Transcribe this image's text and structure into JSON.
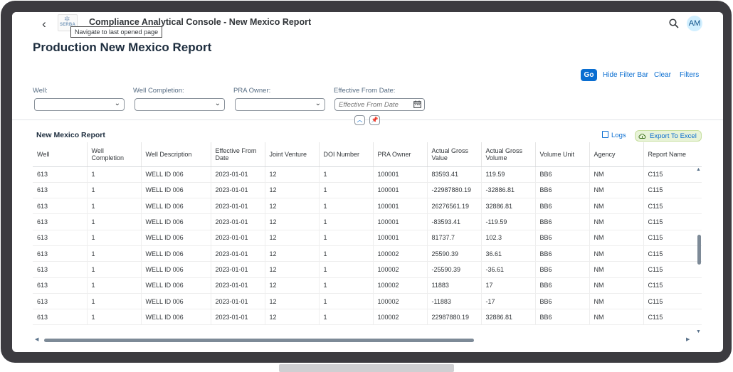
{
  "app": {
    "title": "Compliance Analytical Console - New Mexico Report",
    "logo_text": "SERBA",
    "tooltip": "Navigate to last opened page",
    "avatar_initials": "AM"
  },
  "page": {
    "title": "Production New Mexico Report"
  },
  "filterbar": {
    "go_label": "Go",
    "hide_label": "Hide Filter Bar",
    "clear_label": "Clear",
    "filters_label": "Filters",
    "well_label": "Well:",
    "well_completion_label": "Well Completion:",
    "pra_owner_label": "PRA Owner:",
    "eff_date_label": "Effective From Date:",
    "eff_date_placeholder": "Effective From Date"
  },
  "table": {
    "title": "New Mexico Report",
    "logs_label": "Logs",
    "export_label": "Export To Excel",
    "columns": [
      "Well",
      "Well Completion",
      "Well Description",
      "Effective From Date",
      "Joint Venture",
      "DOI Number",
      "PRA Owner",
      "Actual Gross Value",
      "Actual Gross Volume",
      "Volume Unit",
      "Agency",
      "Report Name"
    ],
    "rows": [
      [
        "613",
        "1",
        "WELL ID 006",
        "2023-01-01",
        "12",
        "1",
        "100001",
        "83593.41",
        "119.59",
        "BB6",
        "NM",
        "C115"
      ],
      [
        "613",
        "1",
        "WELL ID 006",
        "2023-01-01",
        "12",
        "1",
        "100001",
        "-22987880.19",
        "-32886.81",
        "BB6",
        "NM",
        "C115"
      ],
      [
        "613",
        "1",
        "WELL ID 006",
        "2023-01-01",
        "12",
        "1",
        "100001",
        "26276561.19",
        "32886.81",
        "BB6",
        "NM",
        "C115"
      ],
      [
        "613",
        "1",
        "WELL ID 006",
        "2023-01-01",
        "12",
        "1",
        "100001",
        "-83593.41",
        "-119.59",
        "BB6",
        "NM",
        "C115"
      ],
      [
        "613",
        "1",
        "WELL ID 006",
        "2023-01-01",
        "12",
        "1",
        "100001",
        "81737.7",
        "102.3",
        "BB6",
        "NM",
        "C115"
      ],
      [
        "613",
        "1",
        "WELL ID 006",
        "2023-01-01",
        "12",
        "1",
        "100002",
        "25590.39",
        "36.61",
        "BB6",
        "NM",
        "C115"
      ],
      [
        "613",
        "1",
        "WELL ID 006",
        "2023-01-01",
        "12",
        "1",
        "100002",
        "-25590.39",
        "-36.61",
        "BB6",
        "NM",
        "C115"
      ],
      [
        "613",
        "1",
        "WELL ID 006",
        "2023-01-01",
        "12",
        "1",
        "100002",
        "11883",
        "17",
        "BB6",
        "NM",
        "C115"
      ],
      [
        "613",
        "1",
        "WELL ID 006",
        "2023-01-01",
        "12",
        "1",
        "100002",
        "-11883",
        "-17",
        "BB6",
        "NM",
        "C115"
      ],
      [
        "613",
        "1",
        "WELL ID 006",
        "2023-01-01",
        "12",
        "1",
        "100002",
        "22987880.19",
        "32886.81",
        "BB6",
        "NM",
        "C115"
      ]
    ]
  },
  "colors": {
    "accent": "#0a6ed1",
    "bezel": "#3c3b40",
    "export_bg": "#e8f3d8"
  }
}
